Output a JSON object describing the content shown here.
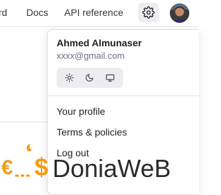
{
  "nav": {
    "links": [
      "rd",
      "Docs",
      "API reference"
    ],
    "settings_icon": "gear-icon",
    "avatar_icon": "user-avatar"
  },
  "menu": {
    "user_name": "Ahmed Almunaser",
    "user_email": "xxxx@gmail.com",
    "theme_options": [
      "sun-icon",
      "moon-icon",
      "monitor-icon"
    ],
    "items": [
      "Your profile",
      "Terms & policies",
      "Log out"
    ]
  },
  "watermark": {
    "text": "DoniaWeB",
    "colors": {
      "orange": "#f39c12",
      "dark": "#2b2b2b"
    }
  }
}
